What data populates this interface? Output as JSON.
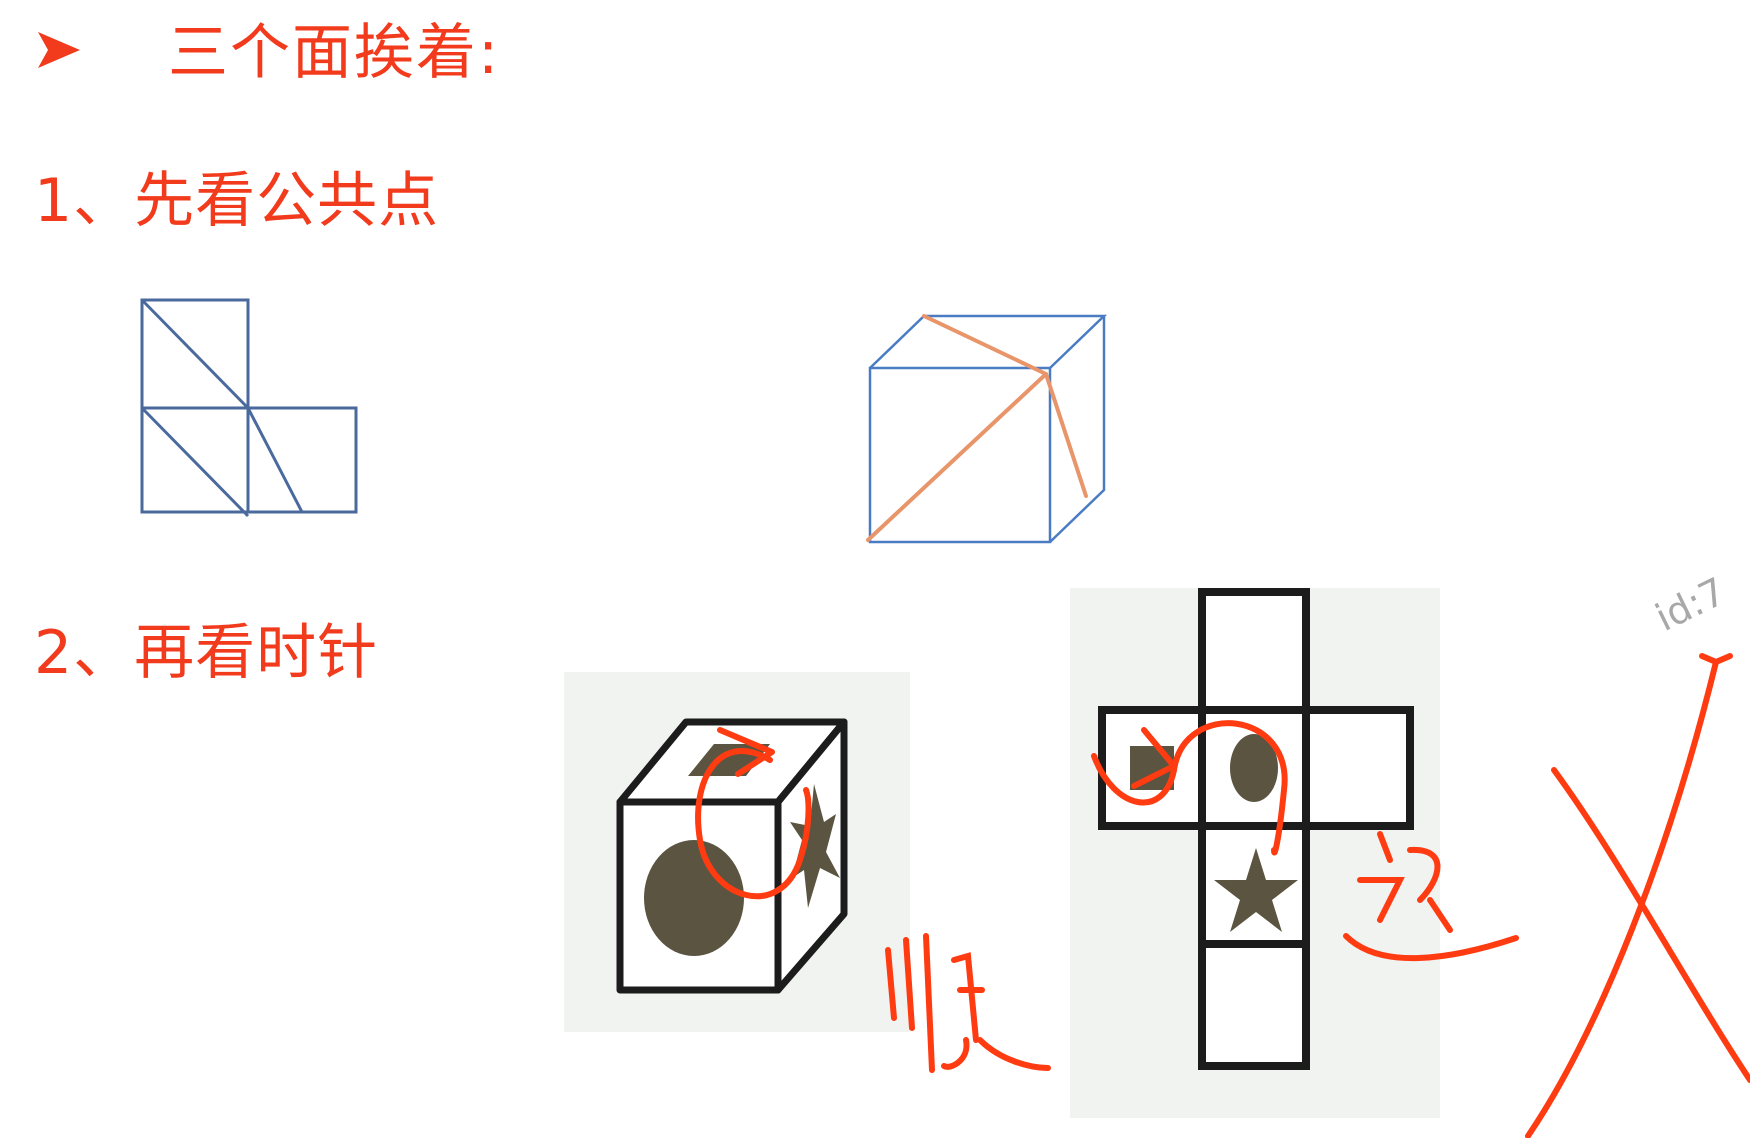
{
  "slide": {
    "heading": "三个面挨着:",
    "step1": "1、先看公共点",
    "step2": "2、再看时针",
    "watermark": "id:7"
  },
  "annotations": {
    "clockwise": "顺",
    "counter": "逆"
  },
  "colors": {
    "text_red": "#f23a1c",
    "net_blue": "#4a6a9e",
    "cube_blue": "#4a7cc4",
    "cube_orange": "#e8956a",
    "ink_red": "#ff3b12",
    "shape_dark": "#5a5440"
  },
  "icons": {
    "bullet": "arrowhead-bullet"
  }
}
